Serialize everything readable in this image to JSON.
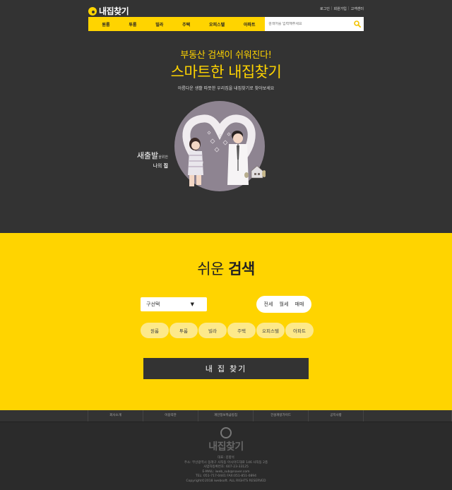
{
  "header": {
    "logo_text": "내집찾기",
    "util_links": [
      "로그인",
      "회원가입",
      "고객센터"
    ]
  },
  "nav": {
    "items": [
      "원룸",
      "투룸",
      "빌라",
      "주택",
      "오피스텔",
      "아파트"
    ],
    "search_placeholder": "검색어를 입력해주세요"
  },
  "hero": {
    "subtitle": "부동산 검색이 쉬워진다!",
    "title": "스마트한 내집찾기",
    "desc": "아름다운 생활 따뜻한 우리집을 내집찾기로 찾아보세요",
    "tag_main": "새출발",
    "tag_small": "을위한",
    "tag_line2_prefix": "나의 ",
    "tag_line2_bold": "집"
  },
  "search": {
    "title_light": "쉬운 ",
    "title_bold": "검색",
    "select_value": "구선택",
    "select_arrow": "▼",
    "deals": [
      "전세",
      "월세",
      "매매"
    ],
    "types": [
      "원룸",
      "투룸",
      "빌라",
      "주택",
      "오피스텔",
      "아파트"
    ],
    "find_button": "내 집 찾기"
  },
  "footer": {
    "links": [
      "회사소개",
      "이용약관",
      "개인정보취급방침",
      "건설개방가이드",
      "공지사항"
    ],
    "logo_text": "내집찾기",
    "info": [
      "대표: 김향석",
      "주소: 부산광역시 동래구 사직동 아시아드대로 146 사직동 2층",
      "사업자등록번호: 607-23-33125",
      "E-MAIL: iweb_sub@naver.com",
      "TEL: 051-717-0441 FAX:051-851-0894",
      "Copyright©2018 iwebsoft. ALL RIGHTS RESERVED"
    ]
  },
  "colors": {
    "accent": "#ffd400",
    "dark": "#333333"
  }
}
